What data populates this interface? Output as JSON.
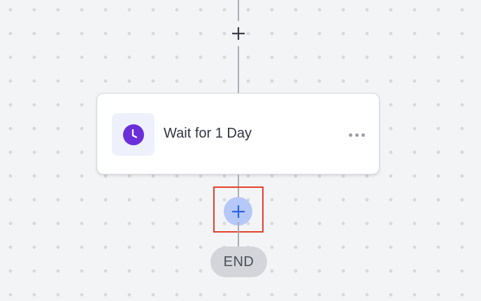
{
  "workflow": {
    "steps": [
      {
        "type": "wait",
        "icon": "clock-icon",
        "title": "Wait for 1 Day"
      }
    ],
    "end_label": "END"
  },
  "colors": {
    "canvas_background": "#f3f4f6",
    "connector": "#a9acb3",
    "wait_icon_purple": "#6a2fd8",
    "add_button_fill": "#b6c8f7",
    "add_button_plus": "#2f64e0",
    "highlight_border": "#e2412b",
    "end_pill": "#d3d5da"
  }
}
